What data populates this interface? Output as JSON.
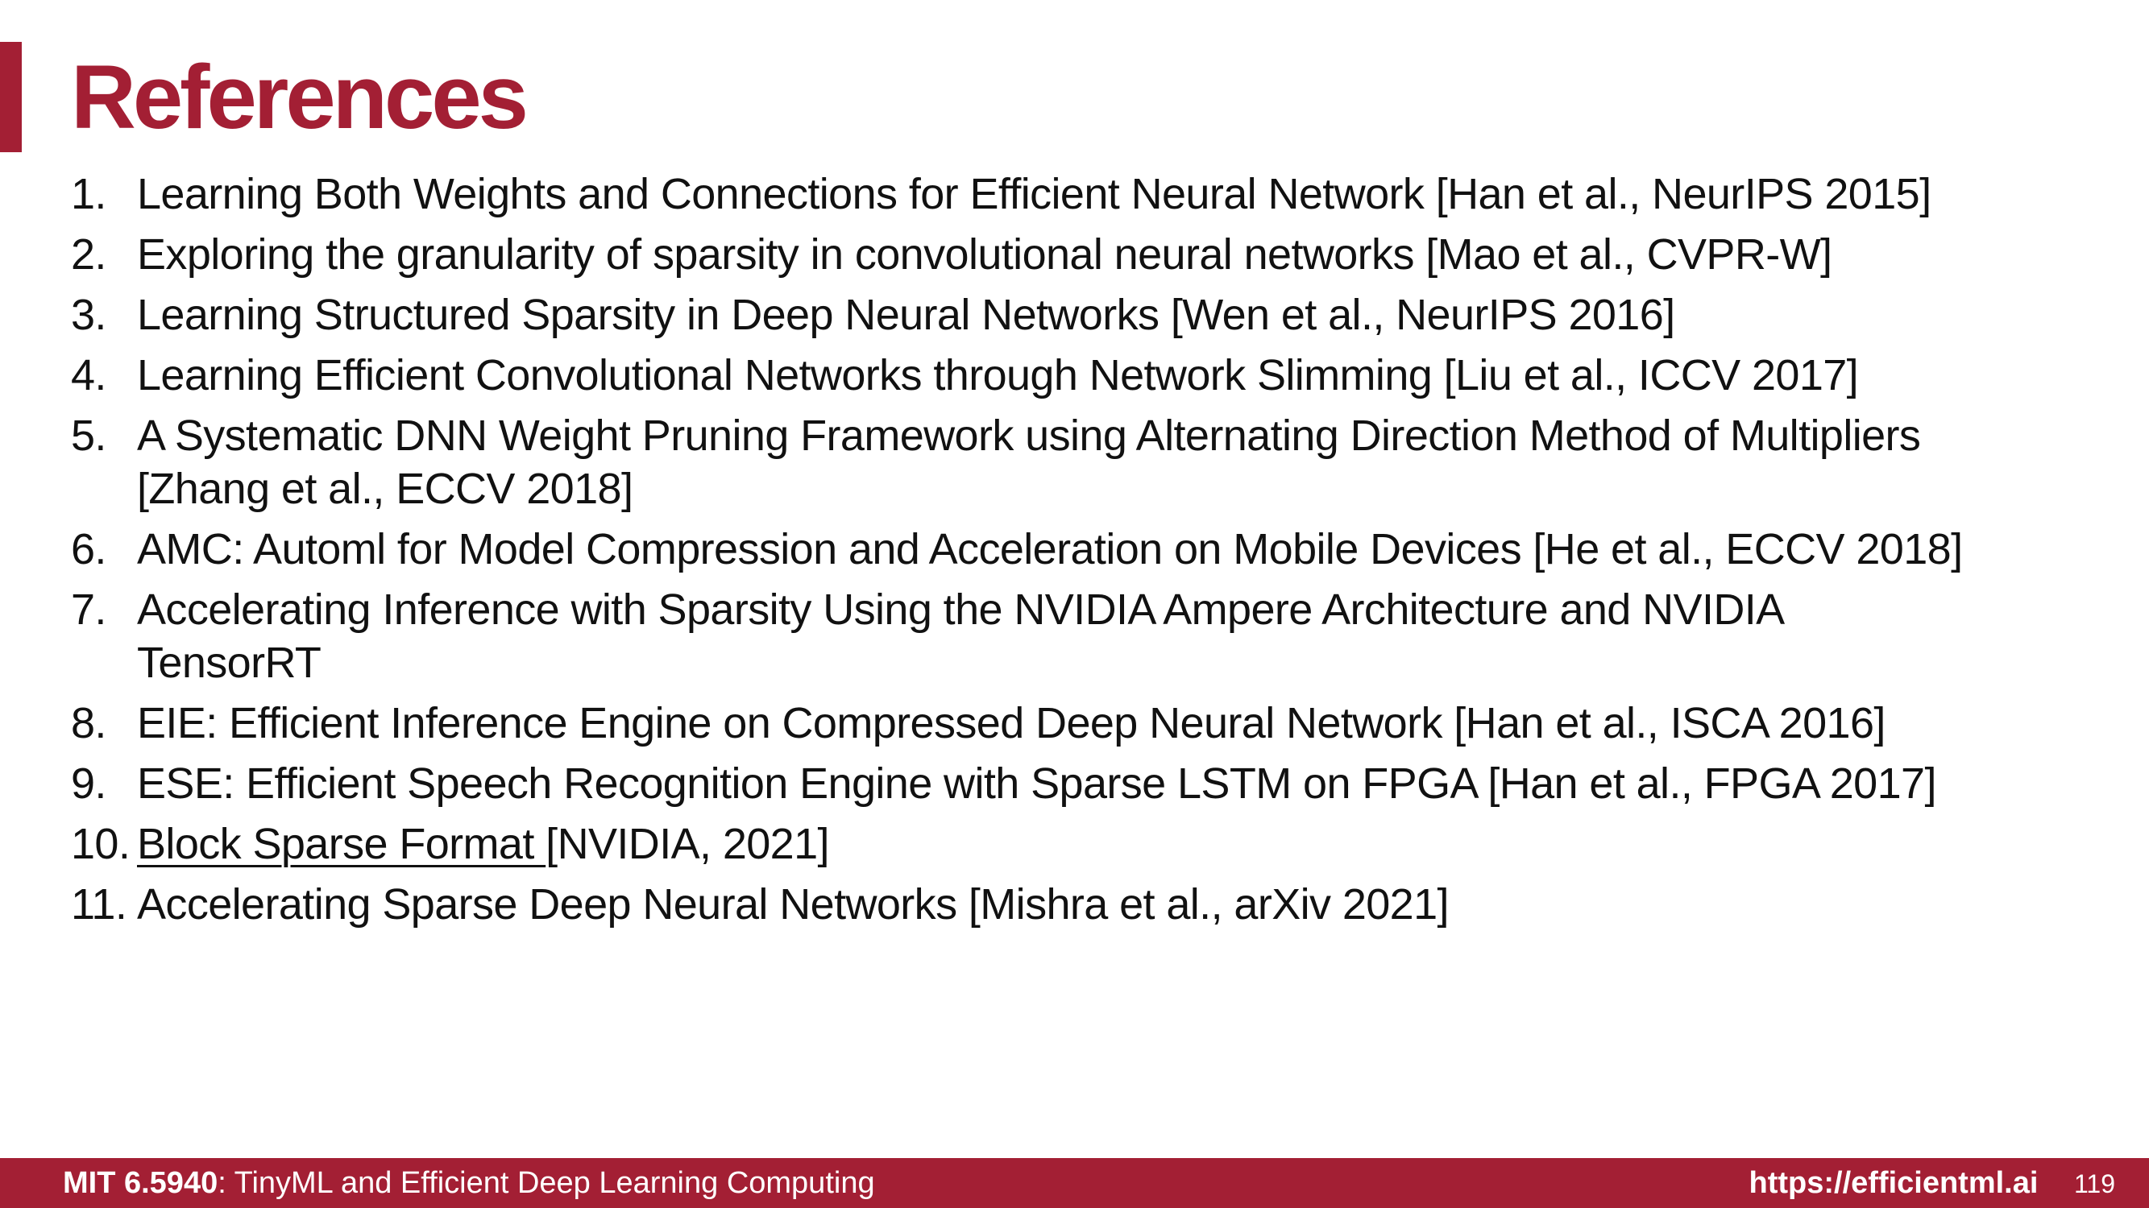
{
  "slide": {
    "title": "References",
    "accent_color": "#a31f34"
  },
  "references": [
    {
      "num": "1.",
      "line1": "Learning Both Weights and Connections for Efficient Neural Network [Han et al., NeurIPS 2015]"
    },
    {
      "num": "2.",
      "line1": "Exploring the granularity of sparsity in convolutional neural networks [Mao et al., CVPR-W]"
    },
    {
      "num": "3.",
      "line1": "Learning Structured Sparsity in Deep Neural Networks [Wen et al., NeurIPS 2016]"
    },
    {
      "num": "4.",
      "line1": "Learning Efficient Convolutional Networks through Network Slimming [Liu et al., ICCV 2017]"
    },
    {
      "num": "5.",
      "line1": "A Systematic DNN Weight Pruning Framework using Alternating Direction Method of Multipliers",
      "line2": "[Zhang et al., ECCV 2018]"
    },
    {
      "num": "6.",
      "line1": "AMC: Automl for Model Compression and Acceleration on Mobile Devices [He et al., ECCV 2018]"
    },
    {
      "num": "7.",
      "line1": "Accelerating Inference with Sparsity Using the NVIDIA Ampere Architecture and NVIDIA",
      "line2": "TensorRT"
    },
    {
      "num": "8.",
      "line1": "EIE: Efficient Inference Engine on Compressed Deep Neural Network [Han et al., ISCA 2016]"
    },
    {
      "num": "9.",
      "line1": "ESE: Efficient Speech Recognition Engine with Sparse LSTM on FPGA [Han et al., FPGA 2017]"
    },
    {
      "num": "10.",
      "link": "Block Sparse Format ",
      "rest": "[NVIDIA, 2021]"
    },
    {
      "num": "11.",
      "line1": "Accelerating Sparse Deep Neural Networks [Mishra et al., arXiv 2021]"
    }
  ],
  "footer": {
    "course_code": "MIT 6.5940",
    "course_name": ": TinyML and Efficient Deep Learning Computing",
    "url": "https://efficientml.ai",
    "page_number": "119"
  }
}
